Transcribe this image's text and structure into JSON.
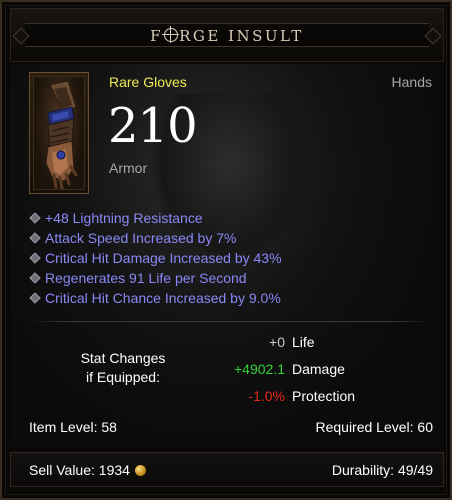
{
  "item": {
    "name": "FORGE INSULT",
    "rarity": "Rare Gloves",
    "slot": "Hands",
    "armor_value": "210",
    "armor_label": "Armor",
    "icon": "gloves-icon",
    "affixes": [
      "+48 Lightning Resistance",
      "Attack Speed Increased by 7%",
      "Critical Hit Damage Increased by 43%",
      "Regenerates 91 Life per Second",
      "Critical Hit Chance Increased by 9.0%"
    ]
  },
  "stat_changes": {
    "label_line1": "Stat Changes",
    "label_line2": "if Equipped:",
    "rows": [
      {
        "value": "+0",
        "name": "Life",
        "color": "#c8c8c8"
      },
      {
        "value": "+4902.1",
        "name": "Damage",
        "color": "#34d03a"
      },
      {
        "value": "-1.0%",
        "name": "Protection",
        "color": "#e8281c"
      }
    ]
  },
  "levels": {
    "item_level": "Item Level: 58",
    "required_level": "Required Level: 60"
  },
  "footer": {
    "sell_value": "Sell Value: 1934",
    "currency_icon": "gold-coin-icon",
    "durability": "Durability: 49/49"
  },
  "colors": {
    "rare": "#f1ea52",
    "magic_affix": "#8a88f5",
    "positive": "#34d03a",
    "negative": "#e8281c",
    "frame_bronze": "#6b4e2d"
  }
}
